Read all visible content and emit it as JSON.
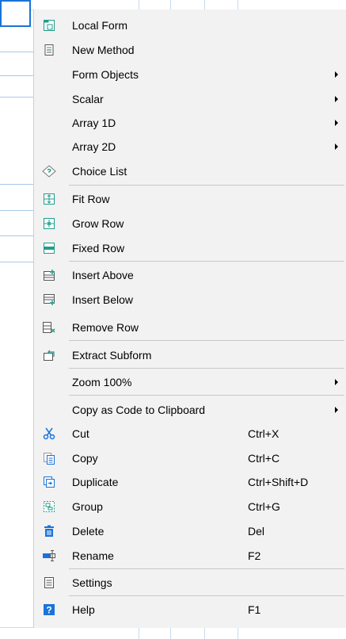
{
  "menu": {
    "items": [
      {
        "label": "Local Form",
        "icon": "local-form-icon",
        "shortcut": "",
        "submenu": false
      },
      {
        "label": "New Method",
        "icon": "method-icon",
        "shortcut": "",
        "submenu": false
      },
      {
        "label": "Form Objects",
        "icon": "",
        "shortcut": "",
        "submenu": true
      },
      {
        "label": "Scalar",
        "icon": "",
        "shortcut": "",
        "submenu": true
      },
      {
        "label": "Array 1D",
        "icon": "",
        "shortcut": "",
        "submenu": true
      },
      {
        "label": "Array 2D",
        "icon": "",
        "shortcut": "",
        "submenu": true
      },
      {
        "label": "Choice List",
        "icon": "choice-list-icon",
        "shortcut": "",
        "submenu": false
      },
      {
        "label": "Fit Row",
        "icon": "fit-row-icon",
        "shortcut": "",
        "submenu": false
      },
      {
        "label": "Grow Row",
        "icon": "grow-row-icon",
        "shortcut": "",
        "submenu": false
      },
      {
        "label": "Fixed Row",
        "icon": "fixed-row-icon",
        "shortcut": "",
        "submenu": false
      },
      {
        "label": "Insert Above",
        "icon": "insert-above-icon",
        "shortcut": "",
        "submenu": false
      },
      {
        "label": "Insert Below",
        "icon": "insert-below-icon",
        "shortcut": "",
        "submenu": false
      },
      {
        "label": "Remove Row",
        "icon": "remove-row-icon",
        "shortcut": "",
        "submenu": false
      },
      {
        "label": "Extract Subform",
        "icon": "extract-subform-icon",
        "shortcut": "",
        "submenu": false
      },
      {
        "label": "Zoom 100%",
        "icon": "",
        "shortcut": "",
        "submenu": true
      },
      {
        "label": "Copy as Code to Clipboard",
        "icon": "",
        "shortcut": "",
        "submenu": true
      },
      {
        "label": "Cut",
        "icon": "scissors-icon",
        "shortcut": "Ctrl+X",
        "submenu": false
      },
      {
        "label": "Copy",
        "icon": "copy-icon",
        "shortcut": "Ctrl+C",
        "submenu": false
      },
      {
        "label": "Duplicate",
        "icon": "duplicate-icon",
        "shortcut": "Ctrl+Shift+D",
        "submenu": false
      },
      {
        "label": "Group",
        "icon": "group-icon",
        "shortcut": "Ctrl+G",
        "submenu": false
      },
      {
        "label": "Delete",
        "icon": "trash-icon",
        "shortcut": "Del",
        "submenu": false
      },
      {
        "label": "Rename",
        "icon": "rename-icon",
        "shortcut": "F2",
        "submenu": false
      },
      {
        "label": "Settings",
        "icon": "settings-icon",
        "shortcut": "",
        "submenu": false
      },
      {
        "label": "Help",
        "icon": "help-icon",
        "shortcut": "F1",
        "submenu": false
      }
    ]
  },
  "colors": {
    "menu_bg": "#f2f2f2",
    "accent_teal": "#1f9e8c",
    "accent_blue": "#1a73d9",
    "icon_gray": "#6b6b6b"
  }
}
